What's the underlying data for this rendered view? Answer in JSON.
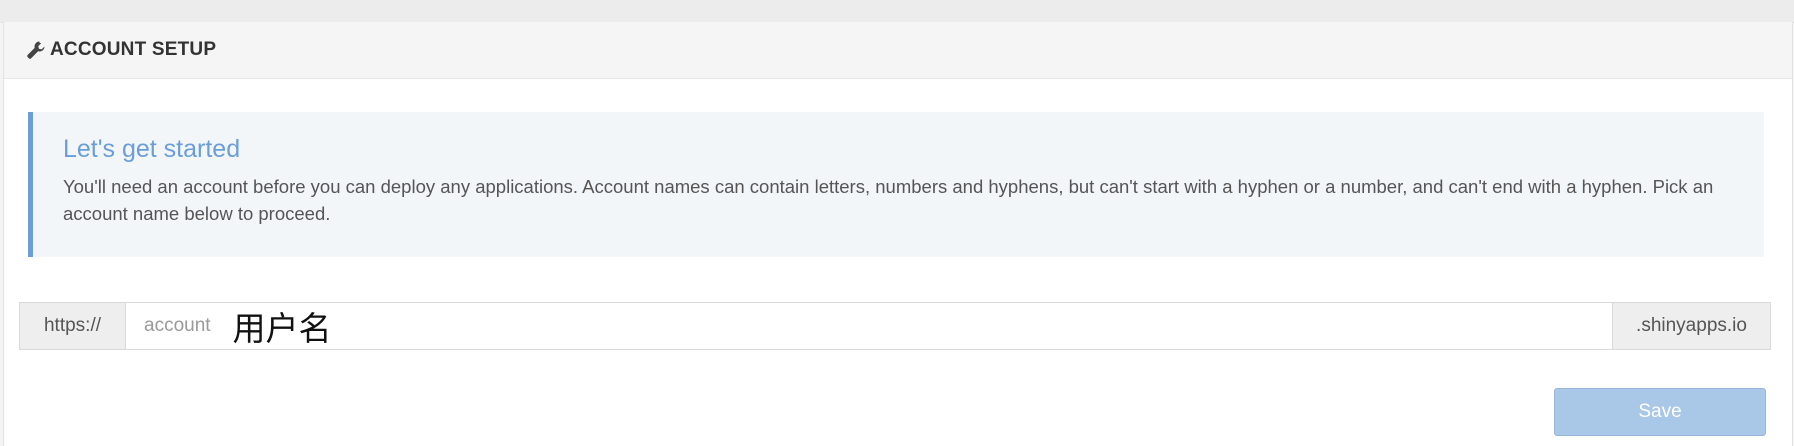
{
  "header": {
    "icon": "wrench-icon",
    "title": "ACCOUNT SETUP"
  },
  "callout": {
    "title": "Let's get started",
    "body": "You'll need an account before you can deploy any applications. Account names can contain letters, numbers and hyphens, but can't start with a hyphen or a number, and can't end with a hyphen. Pick an account name below to proceed.",
    "accent_color": "#6b9ed8"
  },
  "account_input": {
    "prefix": "https://",
    "placeholder": "account",
    "value": "用户名",
    "suffix": ".shinyapps.io"
  },
  "actions": {
    "save_label": "Save",
    "save_color": "#a9c7e6"
  }
}
